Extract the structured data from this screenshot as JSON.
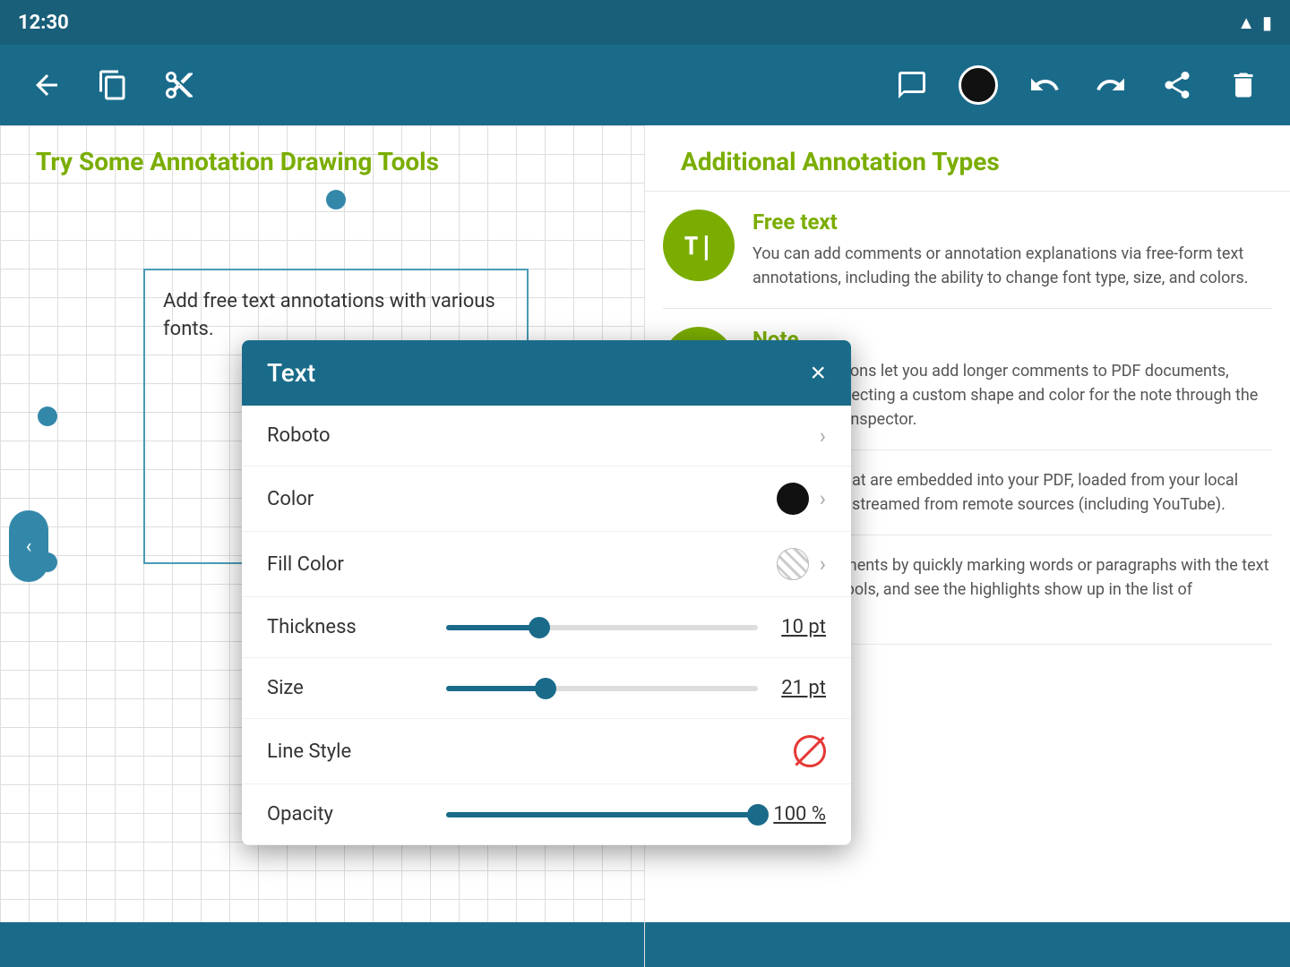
{
  "statusBar": {
    "time": "12:30",
    "signalIcon": "signal-icon",
    "batteryIcon": "battery-icon"
  },
  "toolbar": {
    "backLabel": "←",
    "copyLabel": "⧉",
    "scissorsLabel": "✂",
    "commentLabel": "💬",
    "undoLabel": "↺",
    "redoLabel": "↻",
    "shareLabel": "⎋",
    "deleteLabel": "🗑"
  },
  "leftPanel": {
    "title": "Try Some Annotation Drawing Tools",
    "annotationText": "Add free text annotations with various fonts."
  },
  "rightPanel": {
    "title": "Additional Annotation Types",
    "types": [
      {
        "name": "Free text",
        "iconLabel": "T|",
        "description": "You can add comments or annotation explanations via free-form text annotations, including the ability to change font type, size, and colors."
      },
      {
        "name": "Note",
        "iconLabel": "—",
        "description": "Note annotations let you add longer comments to PDF documents, along with selecting a custom shape and color for the note through the custom note inspector."
      },
      {
        "name": "",
        "iconLabel": "▶",
        "description": "Play videos that are embedded into your PDF, loaded from your local filesystem, or streamed from remote sources (including YouTube)."
      },
      {
        "name": "",
        "iconLabel": "≡",
        "description": "Review documents by quickly marking words or paragraphs with the text highlighting tools, and see the highlights show up in the list of annotations."
      }
    ]
  },
  "dialog": {
    "title": "Text",
    "closeLabel": "×",
    "rows": [
      {
        "label": "Roboto",
        "type": "chevron"
      },
      {
        "label": "Color",
        "type": "color",
        "colorValue": "#111111"
      },
      {
        "label": "Fill Color",
        "type": "fill"
      },
      {
        "label": "Thickness",
        "type": "slider",
        "sliderPercent": 30,
        "value": "10 pt"
      },
      {
        "label": "Size",
        "type": "slider",
        "sliderPercent": 32,
        "value": "21 pt"
      },
      {
        "label": "Line Style",
        "type": "nostyle"
      },
      {
        "label": "Opacity",
        "type": "slider",
        "sliderPercent": 100,
        "value": "100 %"
      }
    ]
  },
  "colors": {
    "tealDark": "#1a5f7a",
    "teal": "#1a6b8a",
    "green": "#7aad00",
    "annotationBlue": "#3388aa"
  }
}
